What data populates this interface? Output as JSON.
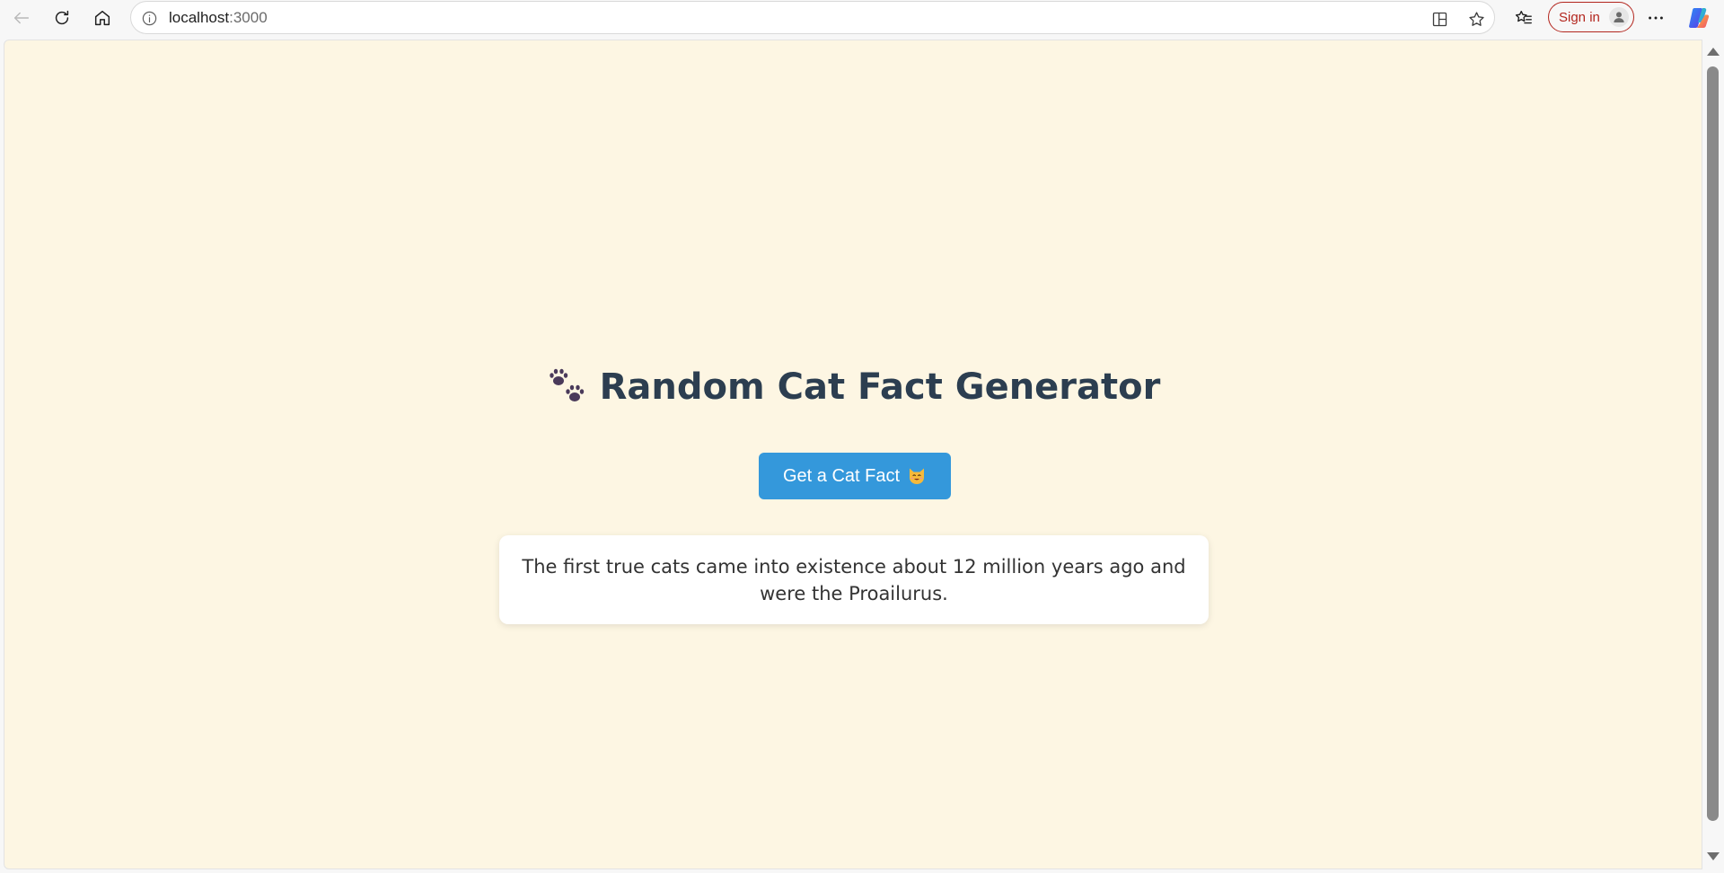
{
  "browser": {
    "url_host": "localhost",
    "url_port": ":3000",
    "sign_in_label": "Sign in",
    "icons": {
      "back": "back-arrow-icon",
      "refresh": "refresh-icon",
      "home": "home-icon",
      "site_info": "info-icon",
      "split_screen": "split-screen-icon",
      "favorite": "star-icon",
      "favorites_list": "favorites-icon",
      "more": "more-icon",
      "copilot": "copilot-icon"
    }
  },
  "page": {
    "background_color": "#fdf6e3",
    "title": "Random Cat Fact Generator",
    "title_icon": "paw-prints-icon",
    "button_label": "Get a Cat Fact",
    "button_icon": "cat-face-icon",
    "button_color": "#3498db",
    "fact_text": "The first true cats came into existence about 12 million years ago and were the Proailurus."
  }
}
